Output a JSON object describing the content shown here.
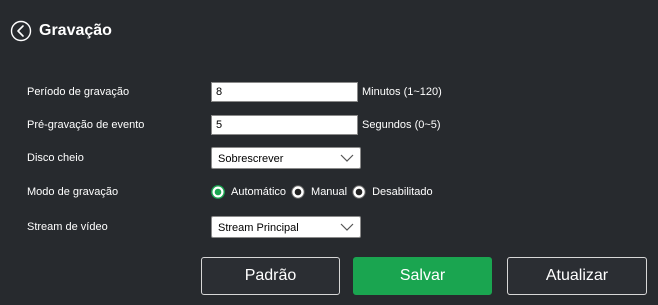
{
  "header": {
    "title": "Gravação",
    "back_icon": "chevron-left-circle-icon"
  },
  "form": {
    "periodo": {
      "label": "Período de gravação",
      "value": "8",
      "unit": "Minutos (1~120)"
    },
    "pre_gravacao": {
      "label": "Pré-gravação de evento",
      "value": "5",
      "unit": "Segundos (0~5)"
    },
    "disco_cheio": {
      "label": "Disco cheio",
      "selected": "Sobrescrever"
    },
    "modo": {
      "label": "Modo de gravação",
      "options": [
        "Automático",
        "Manual",
        "Desabilitado"
      ],
      "selected": "Automático"
    },
    "stream": {
      "label": "Stream de vídeo",
      "selected": "Stream Principal"
    }
  },
  "buttons": {
    "padrao": "Padrão",
    "salvar": "Salvar",
    "atualizar": "Atualizar"
  },
  "colors": {
    "background": "#272a2e",
    "accent": "#1aa550",
    "radio_selected": "#1aa550"
  }
}
